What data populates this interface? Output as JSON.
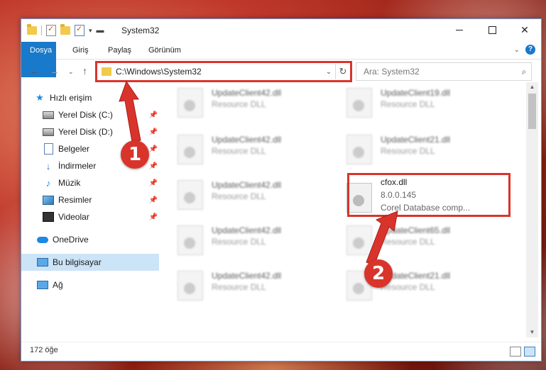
{
  "window": {
    "title": "System32"
  },
  "ribbon": {
    "tabs": [
      "Dosya",
      "Giriş",
      "Paylaş",
      "Görünüm"
    ],
    "help": "?"
  },
  "navigation": {
    "address": "C:\\Windows\\System32",
    "search_placeholder": "Ara: System32"
  },
  "sidebar": {
    "items": [
      {
        "label": "Hızlı erişim",
        "icon": "star-icon"
      },
      {
        "label": "Yerel Disk (C:)",
        "icon": "drive-icon",
        "pinned": true
      },
      {
        "label": "Yerel Disk (D:)",
        "icon": "drive-icon",
        "pinned": true
      },
      {
        "label": "Belgeler",
        "icon": "document-icon",
        "pinned": true
      },
      {
        "label": "İndirmeler",
        "icon": "download-icon",
        "pinned": true
      },
      {
        "label": "Müzik",
        "icon": "music-icon",
        "pinned": true
      },
      {
        "label": "Resimler",
        "icon": "pictures-icon",
        "pinned": true
      },
      {
        "label": "Videolar",
        "icon": "video-icon",
        "pinned": true
      },
      {
        "label": "OneDrive",
        "icon": "cloud-icon"
      },
      {
        "label": "Bu bilgisayar",
        "icon": "computer-icon",
        "selected": true
      },
      {
        "label": "Ağ",
        "icon": "network-icon"
      }
    ]
  },
  "files": [
    {
      "name": "UpdateClient42.dll",
      "sub": "Resource DLL"
    },
    {
      "name": "UpdateClient19.dll",
      "sub": "Resource DLL"
    },
    {
      "name": "UpdateClient42.dll",
      "sub": "Resource DLL"
    },
    {
      "name": "UpdateClient21.dll",
      "sub": "Resource DLL"
    },
    {
      "name": "UpdateClient42.dll",
      "sub": "Resource DLL"
    },
    {
      "name": "UpdateClient42.dll",
      "sub": "Resource DLL"
    },
    {
      "name": "UpdateClient65.dll",
      "sub": "Resource DLL"
    },
    {
      "name": "UpdateClient42.dll",
      "sub": "Resource DLL"
    },
    {
      "name": "UpdateClient21.dll",
      "sub": "Resource DLL"
    }
  ],
  "highlighted_file": {
    "name": "cfox.dll",
    "version": "8.0.0.145",
    "description": "Corel Database comp..."
  },
  "status": {
    "item_count": "172 öğe"
  },
  "annotations": {
    "step1": "1",
    "step2": "2",
    "color": "#d9342b"
  },
  "colors": {
    "accent": "#1979ca",
    "selection": "#cce4f7"
  }
}
